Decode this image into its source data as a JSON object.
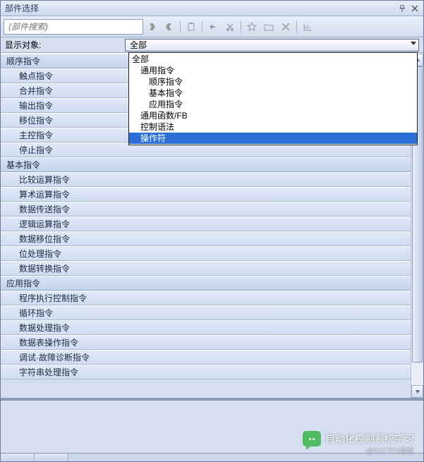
{
  "titlebar": {
    "title": "部件选择"
  },
  "toolbar": {
    "search_placeholder": "(部件搜索)"
  },
  "filter": {
    "label": "显示对象:",
    "selected": "全部"
  },
  "dropdown": {
    "options": [
      {
        "label": "全部",
        "indent": 0,
        "selected": false
      },
      {
        "label": "通用指令",
        "indent": 1,
        "selected": false
      },
      {
        "label": "顺序指令",
        "indent": 2,
        "selected": false
      },
      {
        "label": "基本指令",
        "indent": 2,
        "selected": false
      },
      {
        "label": "应用指令",
        "indent": 2,
        "selected": false
      },
      {
        "label": "通用函数/FB",
        "indent": 1,
        "selected": false
      },
      {
        "label": "控制语法",
        "indent": 1,
        "selected": false
      },
      {
        "label": "操作符",
        "indent": 1,
        "selected": true
      }
    ]
  },
  "tree": {
    "groups": [
      {
        "category": "顺序指令",
        "items": [
          "触点指令",
          "合并指令",
          "输出指令",
          "移位指令",
          "主控指令",
          "停止指令"
        ]
      },
      {
        "category": "基本指令",
        "items": [
          "比较运算指令",
          "算术运算指令",
          "数据传送指令",
          "逻辑运算指令",
          "数据移位指令",
          "位处理指令",
          "数据转换指令"
        ]
      },
      {
        "category": "应用指令",
        "items": [
          "程序执行控制指令",
          "循环指令",
          "数据处理指令",
          "数据表操作指令",
          "调试·故障诊断指令",
          "字符串处理指令"
        ]
      }
    ]
  },
  "watermark": {
    "text": "自动化控制系统学习",
    "sub": "@51CTO博客"
  }
}
